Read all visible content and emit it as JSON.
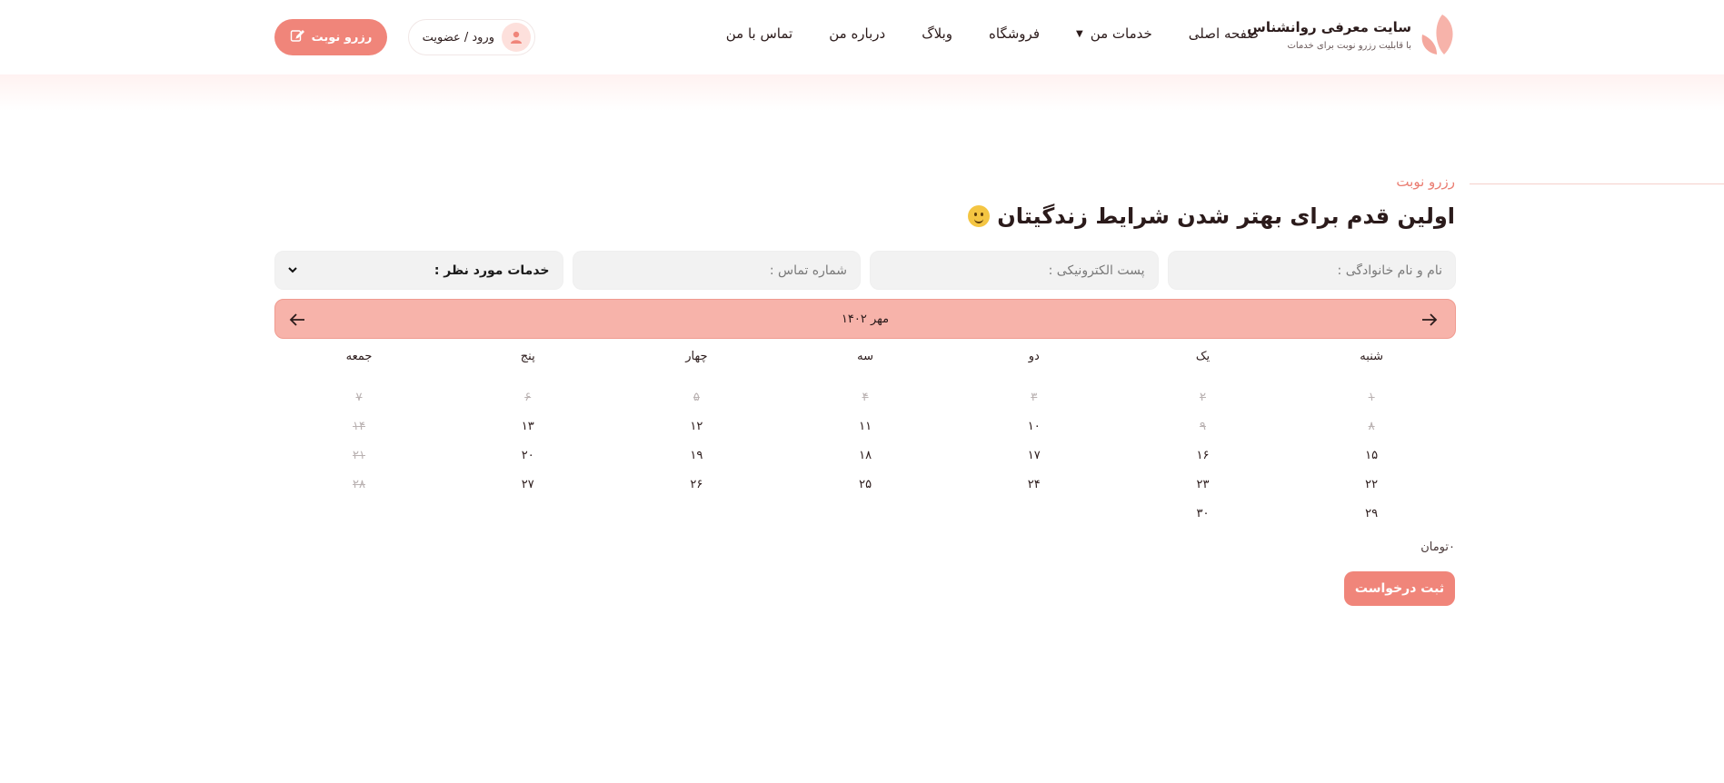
{
  "brand": {
    "title": "سایت معرفی روانشناس",
    "subtitle": "با قابلیت رزرو نوبت برای خدمات",
    "logo_icon": "leaf-logo-icon",
    "accent_color": "#f0857a"
  },
  "nav": {
    "items": [
      {
        "label": "صفحه اصلی"
      },
      {
        "label": "خدمات من",
        "has_dropdown": true
      },
      {
        "label": "فروشگاه"
      },
      {
        "label": "وبلاگ"
      },
      {
        "label": "درباره من"
      },
      {
        "label": "تماس با من"
      }
    ]
  },
  "header_actions": {
    "login_label": "ورود / عضویت",
    "login_icon": "user-icon",
    "reserve_label": "رزرو نوبت",
    "reserve_icon": "edit-icon"
  },
  "main": {
    "eyebrow": "رزرو نوبت",
    "title": "اولین قدم برای بهتر شدن شرایط زندگیتان",
    "form": {
      "name_placeholder": "نام و نام خانوادگی :",
      "email_placeholder": "پست الکترونیکی :",
      "phone_placeholder": "شماره تماس :",
      "service_label": "خدمات مورد نظر :"
    },
    "calendar": {
      "month_label": "مهر ۱۴۰۲",
      "day_names": [
        "شنبه",
        "یک",
        "دو",
        "سه",
        "چهار",
        "پنج",
        "جمعه"
      ],
      "weeks": [
        [
          {
            "d": "۱",
            "past": true
          },
          {
            "d": "۲",
            "past": true
          },
          {
            "d": "۳",
            "past": true
          },
          {
            "d": "۴",
            "past": true
          },
          {
            "d": "۵",
            "past": true
          },
          {
            "d": "۶",
            "past": true
          },
          {
            "d": "۷",
            "past": true
          }
        ],
        [
          {
            "d": "۸",
            "past": true
          },
          {
            "d": "۹",
            "past": true
          },
          {
            "d": "۱۰"
          },
          {
            "d": "۱۱"
          },
          {
            "d": "۱۲"
          },
          {
            "d": "۱۳"
          },
          {
            "d": "۱۴",
            "past": true
          }
        ],
        [
          {
            "d": "۱۵"
          },
          {
            "d": "۱۶"
          },
          {
            "d": "۱۷"
          },
          {
            "d": "۱۸"
          },
          {
            "d": "۱۹"
          },
          {
            "d": "۲۰"
          },
          {
            "d": "۲۱",
            "past": true
          }
        ],
        [
          {
            "d": "۲۲"
          },
          {
            "d": "۲۳"
          },
          {
            "d": "۲۴"
          },
          {
            "d": "۲۵"
          },
          {
            "d": "۲۶"
          },
          {
            "d": "۲۷"
          },
          {
            "d": "۲۸",
            "past": true
          }
        ],
        [
          {
            "d": "۲۹"
          },
          {
            "d": "۳۰"
          },
          {
            "d": ""
          },
          {
            "d": ""
          },
          {
            "d": ""
          },
          {
            "d": ""
          },
          {
            "d": ""
          }
        ]
      ]
    },
    "price": "۰تومان",
    "submit_label": "ثبت درخواست"
  }
}
